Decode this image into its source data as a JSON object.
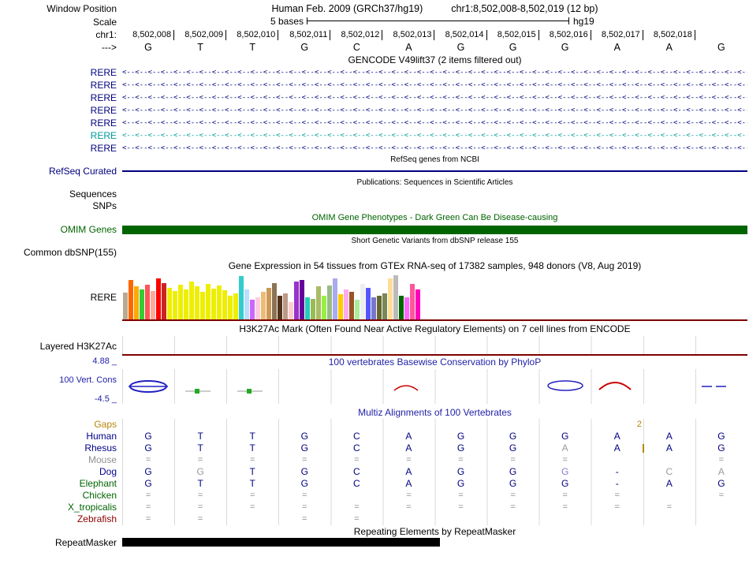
{
  "colors": {
    "navy": "#000080",
    "teal_transcript": "#009999",
    "omim_green": "#006400",
    "maroon_line": "#7D0000",
    "gaps_orange": "#B8860B",
    "cons_blue": "#2222A8"
  },
  "header": {
    "window_label": "Window Position",
    "assembly": "Human Feb. 2009 (GRCh37/hg19)",
    "range": "chr1:8,502,008-8,502,019 (12 bp)"
  },
  "scale": {
    "label": "Scale",
    "bar_label": "5 bases",
    "assembly": "hg19"
  },
  "ruler": {
    "chrom_label": "chr1:",
    "strand_label": "--->",
    "positions": [
      "8,502,008",
      "8,502,009",
      "8,502,010",
      "8,502,011",
      "8,502,012",
      "8,502,013",
      "8,502,014",
      "8,502,015",
      "8,502,016",
      "8,502,017",
      "8,502,018"
    ],
    "bases": [
      "G",
      "T",
      "T",
      "G",
      "C",
      "A",
      "G",
      "G",
      "G",
      "A",
      "A",
      "G"
    ]
  },
  "gencode": {
    "title": "GENCODE V49lift37 (2 items filtered out)",
    "items": [
      {
        "label": "RERE",
        "color": "#000080"
      },
      {
        "label": "RERE",
        "color": "#000080"
      },
      {
        "label": "RERE",
        "color": "#000080"
      },
      {
        "label": "RERE",
        "color": "#000080"
      },
      {
        "label": "RERE",
        "color": "#000080"
      },
      {
        "label": "RERE",
        "color": "#009999"
      },
      {
        "label": "RERE",
        "color": "#000080"
      }
    ]
  },
  "refseq": {
    "title": "RefSeq genes from NCBI",
    "label": "RefSeq Curated"
  },
  "publications": {
    "title": "Publications: Sequences in Scientific Articles",
    "sequences_label": "Sequences",
    "snps_label": "SNPs"
  },
  "omim": {
    "title": "OMIM Gene Phenotypes - Dark Green Can Be Disease-causing",
    "label": "OMIM Genes"
  },
  "dbsnp": {
    "title": "Short Genetic Variants from dbSNP release 155",
    "label": "Common dbSNP(155)"
  },
  "gtex": {
    "title": "Gene Expression in 54 tissues from GTEx RNA-seq of 17382 samples, 948 donors (V8, Aug 2019)",
    "label": "RERE",
    "bars": {
      "colors": [
        "#BBA98E",
        "#FF6600",
        "#FFAA00",
        "#33CC33",
        "#FF5555",
        "#FFAA99",
        "#FF0000",
        "#CC2222",
        "#EEEE00",
        "#EEEE00",
        "#EEEE00",
        "#EEEE00",
        "#EEEE00",
        "#EEEE00",
        "#EEEE00",
        "#EEEE00",
        "#EEEE00",
        "#EEEE00",
        "#EEEE00",
        "#EEEE00",
        "#EEEE00",
        "#33CCCC",
        "#BBDDFF",
        "#CC66FF",
        "#FFCCDD",
        "#EEBB77",
        "#CC9955",
        "#8B7355",
        "#55331A",
        "#BB9988",
        "#FFCCCC",
        "#9933CC",
        "#660099",
        "#22CCBB",
        "#99BB55",
        "#AABB66",
        "#99EE44",
        "#99BB88",
        "#AAAAEE",
        "#FFCC00",
        "#FFAAEE",
        "#995522",
        "#AAEE99",
        "#EEEEEE",
        "#5555FF",
        "#7777CC",
        "#666633",
        "#778855",
        "#FFDD99",
        "#BBBBBB",
        "#006600",
        "#FF66FF",
        "#FF5599",
        "#FF00BB"
      ],
      "heights": [
        34,
        50,
        42,
        38,
        44,
        36,
        52,
        46,
        40,
        36,
        44,
        38,
        48,
        42,
        35,
        45,
        39,
        43,
        37,
        30,
        33,
        55,
        38,
        25,
        28,
        35,
        40,
        46,
        30,
        33,
        22,
        48,
        50,
        28,
        26,
        42,
        30,
        43,
        52,
        32,
        38,
        35,
        25,
        45,
        40,
        28,
        30,
        33,
        52,
        56,
        30,
        28,
        45,
        38
      ]
    }
  },
  "h3k27ac": {
    "title": "H3K27Ac Mark (Often Found Near Active Regulatory Elements) on 7 cell lines from ENCODE",
    "label": "Layered H3K27Ac"
  },
  "conservation": {
    "title": "100 vertebrates Basewise Conservation by PhyloP",
    "label": "100 Vert. Cons",
    "max": "4.88 _",
    "min": "-4.5 _"
  },
  "multiz": {
    "title": "Multiz Alignments of 100 Vertebrates",
    "gaps": {
      "label": "Gaps",
      "label_color": "#B8860B"
    },
    "insertion": {
      "row": "Rhesus",
      "col": 10,
      "count": "2"
    },
    "rows": [
      {
        "species": "Human",
        "label_color": "#00008B",
        "bases": [
          "G",
          "T",
          "T",
          "G",
          "C",
          "A",
          "G",
          "G",
          "G",
          "A",
          "A",
          "G"
        ],
        "tones": [
          "n",
          "n",
          "n",
          "n",
          "n",
          "n",
          "n",
          "n",
          "n",
          "n",
          "n",
          "n"
        ]
      },
      {
        "species": "Rhesus",
        "label_color": "#00008B",
        "bases": [
          "G",
          "T",
          "T",
          "G",
          "C",
          "A",
          "G",
          "G",
          "A",
          "A",
          "A",
          "G"
        ],
        "tones": [
          "n",
          "n",
          "n",
          "n",
          "n",
          "n",
          "n",
          "n",
          "g",
          "n",
          "n",
          "n"
        ]
      },
      {
        "species": "Mouse",
        "label_color": "#909090",
        "bases": [
          "=",
          "=",
          "=",
          "=",
          "=",
          "=",
          "=",
          "=",
          "=",
          "",
          "",
          "="
        ],
        "tones": [
          "q",
          "q",
          "q",
          "q",
          "q",
          "q",
          "q",
          "q",
          "q",
          "q",
          "q",
          "q"
        ]
      },
      {
        "species": "Dog",
        "label_color": "#00008B",
        "bases": [
          "G",
          "G",
          "T",
          "G",
          "C",
          "A",
          "G",
          "G",
          "G",
          "-",
          "C",
          "A"
        ],
        "tones": [
          "n",
          "g",
          "n",
          "n",
          "n",
          "n",
          "n",
          "n",
          "b",
          "n",
          "g",
          "g"
        ]
      },
      {
        "species": "Elephant",
        "label_color": "#006400",
        "bases": [
          "G",
          "T",
          "T",
          "G",
          "C",
          "A",
          "G",
          "G",
          "G",
          "-",
          "A",
          "G"
        ],
        "tones": [
          "n",
          "n",
          "n",
          "n",
          "n",
          "n",
          "n",
          "n",
          "n",
          "n",
          "n",
          "n"
        ]
      },
      {
        "species": "Chicken",
        "label_color": "#006400",
        "bases": [
          "=",
          "=",
          "=",
          "=",
          "",
          "=",
          "=",
          "=",
          "=",
          "=",
          "",
          "="
        ],
        "tones": [
          "q",
          "q",
          "q",
          "q",
          "q",
          "q",
          "q",
          "q",
          "q",
          "q",
          "q",
          "q"
        ]
      },
      {
        "species": "X_tropicalis",
        "label_color": "#006400",
        "bases": [
          "=",
          "=",
          "=",
          "=",
          "=",
          "=",
          "=",
          "=",
          "=",
          "=",
          "=",
          ""
        ],
        "tones": [
          "q",
          "q",
          "q",
          "q",
          "q",
          "q",
          "q",
          "q",
          "q",
          "q",
          "q",
          "q"
        ]
      },
      {
        "species": "Zebrafish",
        "label_color": "#8B0000",
        "bases": [
          "=",
          "=",
          "",
          "=",
          "=",
          "",
          "",
          "",
          "",
          "",
          "",
          ""
        ],
        "tones": [
          "q",
          "q",
          "q",
          "q",
          "q",
          "q",
          "q",
          "q",
          "q",
          "q",
          "q",
          "q"
        ]
      }
    ]
  },
  "repeatmasker": {
    "title": "Repeating Elements by RepeatMasker",
    "label": "RepeatMasker"
  }
}
